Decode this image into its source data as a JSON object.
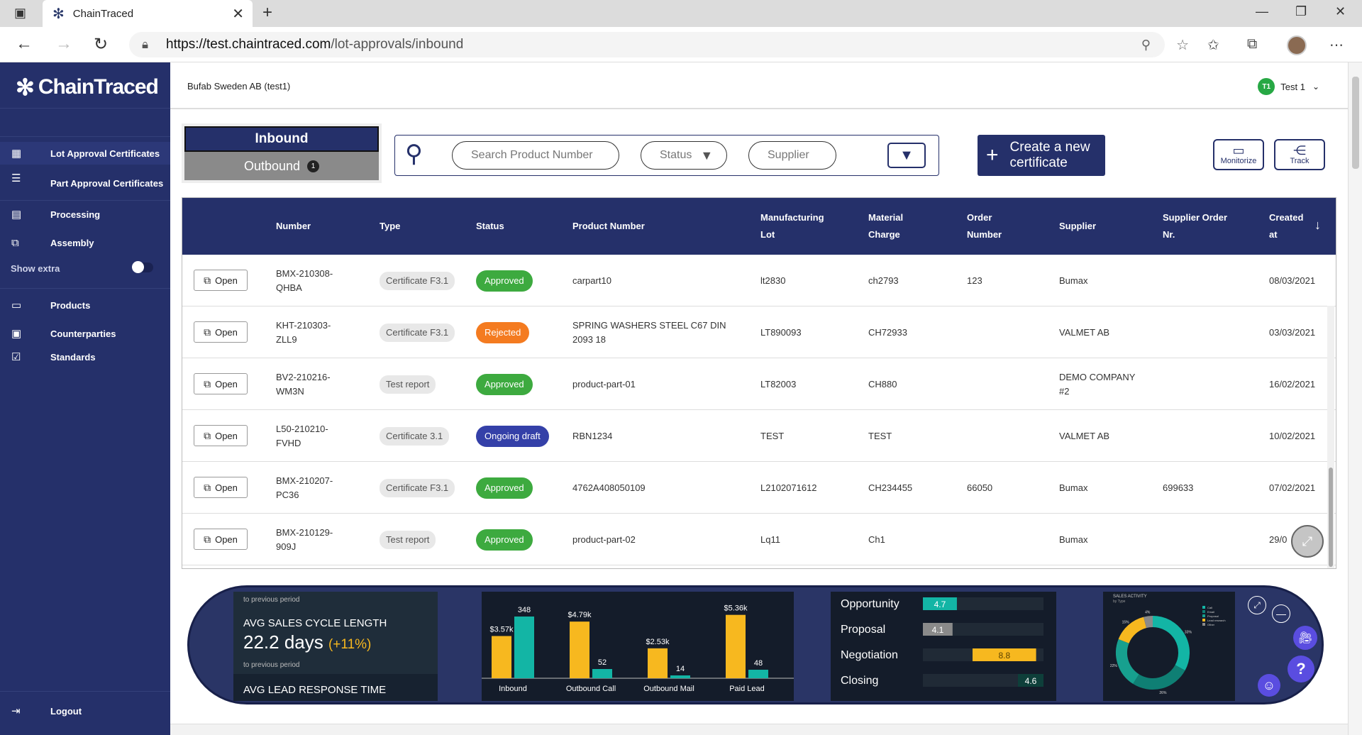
{
  "browser": {
    "tab_title": "ChainTraced",
    "url_host": "https://test.chaintraced.com",
    "url_path": "/lot-approvals/inbound"
  },
  "sidebar": {
    "logo": "ChainTraced",
    "items": [
      {
        "label": "Lot Approval Certificates",
        "icon": "grid-icon"
      },
      {
        "label": "Part Approval Certificates",
        "icon": "list-icon"
      },
      {
        "label": "Processing",
        "icon": "calendar-icon"
      },
      {
        "label": "Assembly",
        "icon": "assembly-icon"
      },
      {
        "label": "Products",
        "icon": "folder-icon"
      },
      {
        "label": "Counterparties",
        "icon": "id-card-icon"
      },
      {
        "label": "Standards",
        "icon": "checkbox-icon"
      }
    ],
    "show_extra": "Show extra",
    "logout": "Logout"
  },
  "topbar": {
    "company": "Bufab Sweden AB (test1)",
    "user_initials": "T1",
    "user_name": "Test 1"
  },
  "controls": {
    "inbound": "Inbound",
    "outbound": "Outbound",
    "outbound_count": "1",
    "search_placeholder": "Search Product Number",
    "status_filter": "Status",
    "supplier_filter": "Supplier",
    "create_line1": "Create a  new",
    "create_line2": "certificate",
    "monitorize": "Monitorize",
    "track": "Track"
  },
  "table": {
    "headers": {
      "number": "Number",
      "type": "Type",
      "status": "Status",
      "product_number": "Product Number",
      "mfg_lot_1": "Manufacturing",
      "mfg_lot_2": "Lot",
      "material_1": "Material",
      "material_2": "Charge",
      "order_1": "Order",
      "order_2": "Number",
      "supplier": "Supplier",
      "sup_order_1": "Supplier Order",
      "sup_order_2": "Nr.",
      "created_1": "Created",
      "created_2": "at"
    },
    "open_label": "Open",
    "rows": [
      {
        "num1": "BMX-210308-",
        "num2": "QHBA",
        "type": "Certificate F3.1",
        "status": "Approved",
        "status_color": "#3daa3f",
        "product": "carpart10",
        "lot": "lt2830",
        "charge": "ch2793",
        "order": "123",
        "supplier": "Bumax",
        "sup_order": "",
        "created": "08/03/2021"
      },
      {
        "num1": "KHT-210303-",
        "num2": "ZLL9",
        "type": "Certificate F3.1",
        "status": "Rejected",
        "status_color": "#f47b20",
        "product": "SPRING WASHERS STEEL C67 DIN 2093 18",
        "lot": "LT890093",
        "charge": "CH72933",
        "order": "",
        "supplier": "VALMET AB",
        "sup_order": "",
        "created": "03/03/2021"
      },
      {
        "num1": "BV2-210216-",
        "num2": "WM3N",
        "type": "Test report",
        "status": "Approved",
        "status_color": "#3daa3f",
        "product": "product-part-01",
        "lot": "LT82003",
        "charge": "CH880",
        "order": "",
        "supplier": "DEMO COMPANY #2",
        "sup_order": "",
        "created": "16/02/2021"
      },
      {
        "num1": "L50-210210-",
        "num2": "FVHD",
        "type": "Certificate 3.1",
        "status": "Ongoing draft",
        "status_color": "#3440a8",
        "product": "RBN1234",
        "lot": "TEST",
        "charge": "TEST",
        "order": "",
        "supplier": "VALMET AB",
        "sup_order": "",
        "created": "10/02/2021"
      },
      {
        "num1": "BMX-210207-",
        "num2": "PC36",
        "type": "Certificate F3.1",
        "status": "Approved",
        "status_color": "#3daa3f",
        "product": "4762A408050109",
        "lot": "L2102071612",
        "charge": "CH234455",
        "order": "66050",
        "supplier": "Bumax",
        "sup_order": "699633",
        "created": "07/02/2021"
      },
      {
        "num1": "BMX-210129-",
        "num2": "909J",
        "type": "Test report",
        "status": "Approved",
        "status_color": "#3daa3f",
        "product": "product-part-02",
        "lot": "Lq11",
        "charge": "Ch1",
        "order": "",
        "supplier": "Bumax",
        "sup_order": "",
        "created": "29/0"
      }
    ]
  },
  "dashboard": {
    "kpi_prev1": "to previous period",
    "kpi_title": "AVG SALES CYCLE LENGTH",
    "kpi_value": "22.2 days",
    "kpi_change": "(+11%)",
    "kpi_prev2": "to previous period",
    "kpi_title2": "AVG LEAD RESPONSE TIME",
    "pie_title": "SALES ACTIVITY",
    "pie_subtitle": "by Type",
    "pie_legend": [
      "Call",
      "Email",
      "Proposal",
      "Lead research",
      "Other"
    ]
  },
  "chart_data": [
    {
      "type": "bar",
      "categories": [
        "Inbound",
        "Outbound Call",
        "Outbound Mail",
        "Paid Lead"
      ],
      "series": [
        {
          "values": [
            3.57,
            4.79,
            2.53,
            5.36
          ],
          "labels": [
            "$3.57k",
            "$4.79k",
            "$2.53k",
            "$5.36k"
          ],
          "color": "#f7b81f"
        },
        {
          "values": [
            348,
            52,
            14,
            48
          ],
          "labels": [
            "348",
            "52",
            "14",
            "48"
          ],
          "color": "#13b5a5"
        }
      ]
    },
    {
      "type": "bar",
      "orientation": "horizontal",
      "categories": [
        "Opportunity",
        "Proposal",
        "Negotiation",
        "Closing"
      ],
      "values": [
        4.7,
        4.1,
        8.8,
        4.6
      ],
      "labels": [
        "4.7",
        "4.1",
        "8.8",
        "4.6"
      ],
      "colors": [
        "#13b5a5",
        "#8a8a8a",
        "#f7b81f",
        "#0e3f3a"
      ]
    },
    {
      "type": "pie",
      "slices": [
        {
          "name": "Call",
          "value": 33,
          "color": "#13b5a5"
        },
        {
          "name": "Email",
          "value": 26,
          "color": "#0f7f74"
        },
        {
          "name": "Proposal",
          "value": 22,
          "color": "#17a08f"
        },
        {
          "name": "Lead research",
          "value": 15,
          "color": "#f7b81f"
        },
        {
          "name": "Other",
          "value": 4,
          "color": "#8a8a8a"
        }
      ],
      "slice_labels": [
        "33%",
        "26%",
        "22%",
        "15%",
        "4%"
      ]
    }
  ],
  "colors": {
    "navy": "#25306a",
    "approved": "#3daa3f",
    "rejected": "#f47b20",
    "draft": "#3440a8"
  }
}
